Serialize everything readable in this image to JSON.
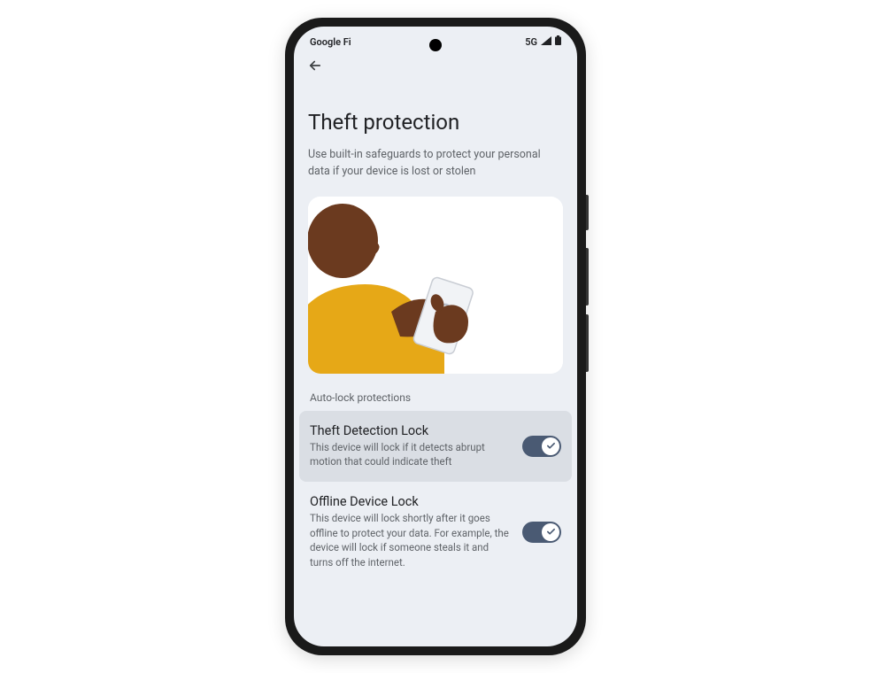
{
  "statusBar": {
    "carrier": "Google Fi",
    "network": "5G"
  },
  "page": {
    "title": "Theft protection",
    "description": "Use built-in safeguards to protect your personal data if your device is lost or stolen"
  },
  "sectionLabel": "Auto-lock protections",
  "settings": [
    {
      "title": "Theft Detection Lock",
      "description": "This device will lock if it detects abrupt motion that could indicate theft",
      "enabled": true
    },
    {
      "title": "Offline Device Lock",
      "description": "This device will lock shortly after it goes offline to protect your data. For example, the device will lock if someone steals it and turns off the internet.",
      "enabled": true
    }
  ]
}
